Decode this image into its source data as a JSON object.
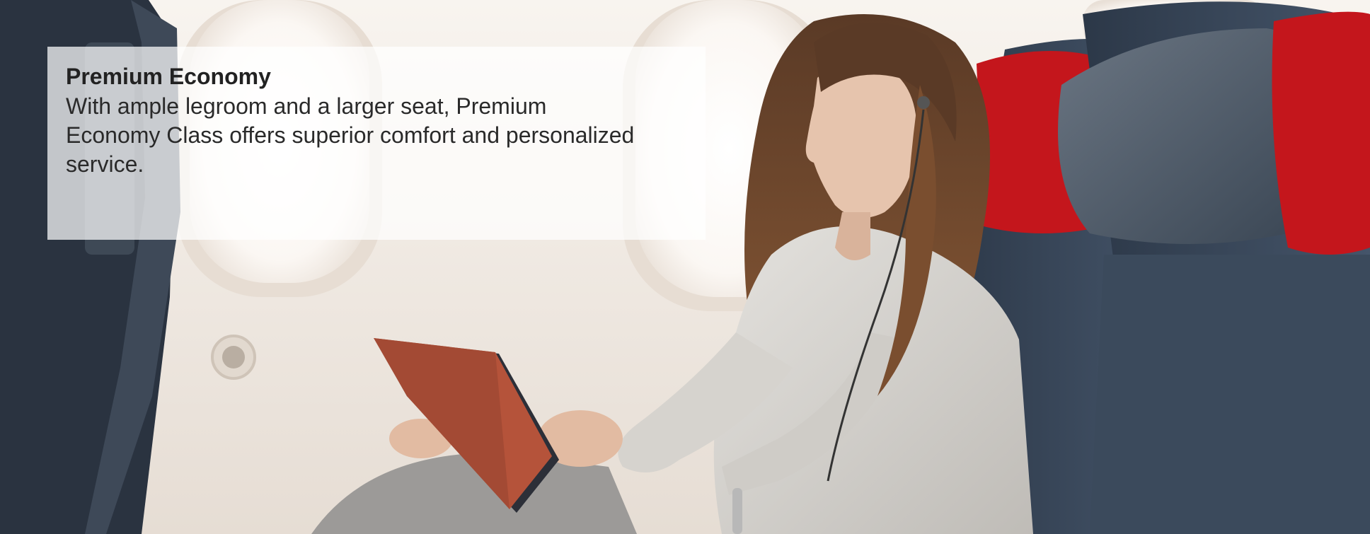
{
  "hero": {
    "title": "Premium Economy",
    "description": "With ample legroom and a larger seat, Premium Economy Class offers superior comfort and personalized service."
  },
  "colors": {
    "seat_red": "#c4161c",
    "seat_gray": "#3b4a5c",
    "cabin_wall": "#f2ece6",
    "tablet_case": "#b5533a",
    "sweater": "#d9d7d3"
  },
  "icons": [
    "passenger-photo",
    "airplane-window",
    "airline-seat",
    "tablet",
    "earphones"
  ]
}
